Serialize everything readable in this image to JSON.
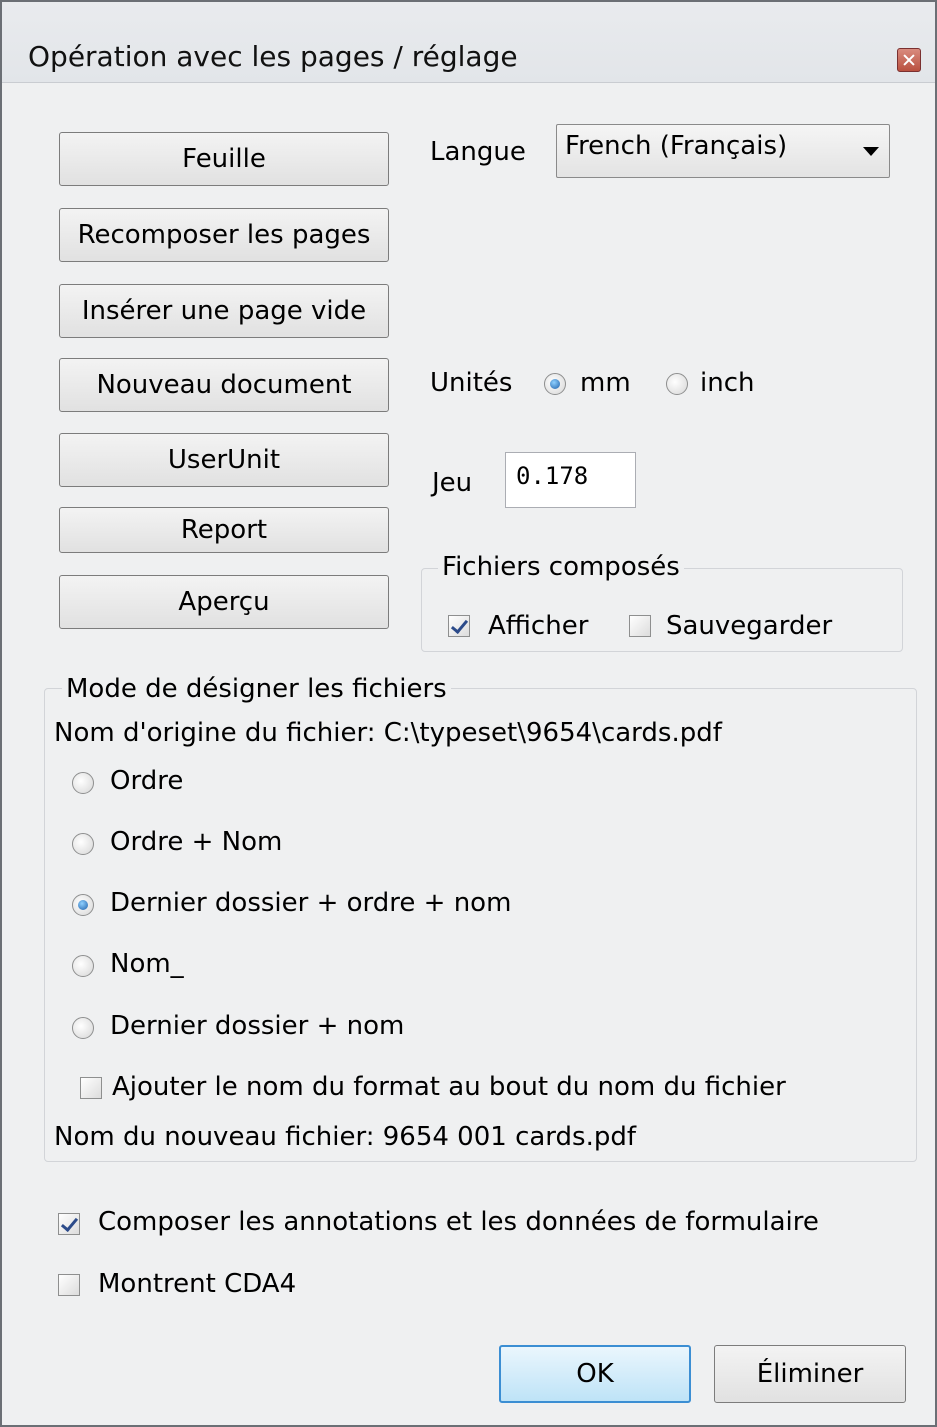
{
  "window": {
    "title": "Opération avec les pages / réglage"
  },
  "left_buttons": [
    "Feuille",
    "Recomposer les pages",
    "Insérer une page vide",
    "Nouveau document",
    "UserUnit",
    "Report",
    "Aperçu"
  ],
  "language": {
    "label": "Langue",
    "selected": "French (Français)"
  },
  "units": {
    "label": "Unités",
    "options": [
      "mm",
      "inch"
    ],
    "selected": "mm"
  },
  "jeu": {
    "label": "Jeu",
    "value": "0.178"
  },
  "composed_files": {
    "title": "Fichiers composés",
    "afficher": {
      "label": "Afficher",
      "checked": true
    },
    "sauvegarder": {
      "label": "Sauvegarder",
      "checked": false
    }
  },
  "naming": {
    "title": "Mode de désigner les fichiers",
    "original_name": "Nom d'origine du fichier: C:\\typeset\\9654\\cards.pdf",
    "options": [
      "Ordre",
      "Ordre + Nom",
      "Dernier dossier + ordre + nom",
      "Nom_",
      "Dernier dossier + nom"
    ],
    "selected_index": 2,
    "append_format": {
      "label": "Ajouter le nom du format au bout du nom du fichier",
      "checked": false
    },
    "new_name": "Nom du nouveau fichier: 9654 001 cards.pdf"
  },
  "compose_annotations": {
    "label": "Composer les annotations et les données de formulaire",
    "checked": true
  },
  "show_cda4": {
    "label": "Montrent CDA4",
    "checked": false
  },
  "footer": {
    "ok_label": "OK",
    "cancel_label": "Éliminer"
  }
}
